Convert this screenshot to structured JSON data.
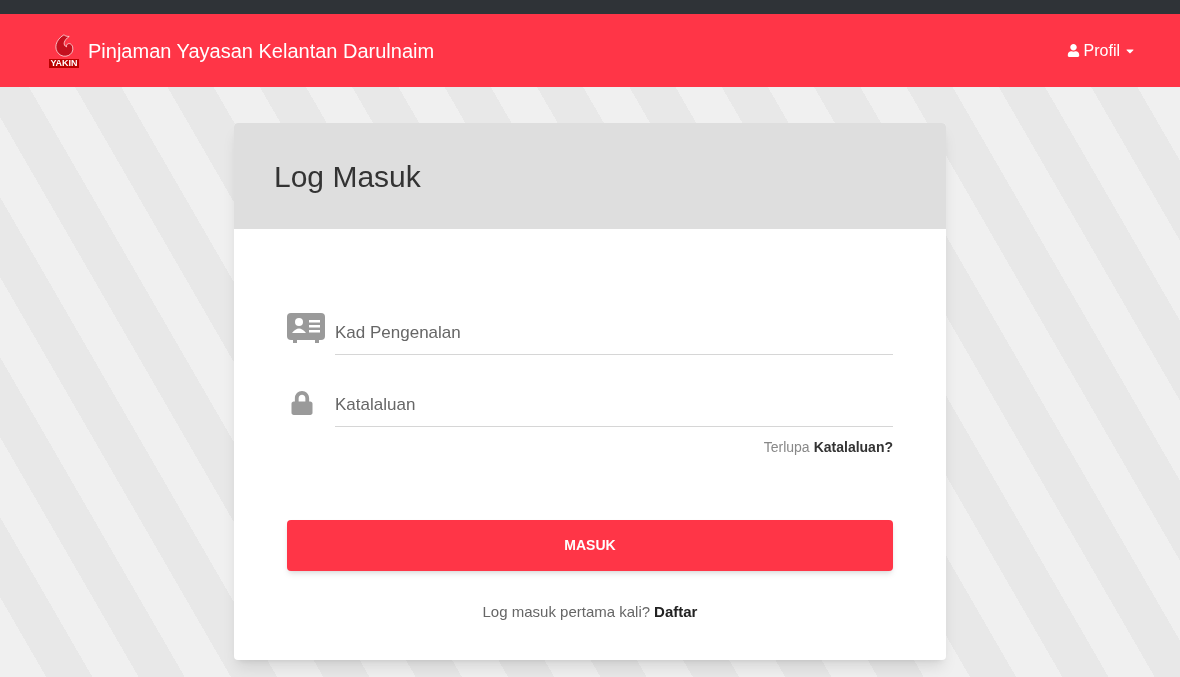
{
  "navbar": {
    "logo_text": "YAKIN",
    "title": "Pinjaman Yayasan Kelantan Darulnaim",
    "profile": "Profil"
  },
  "login_card": {
    "title": "Log Masuk",
    "fields": [
      {
        "kind": "id",
        "placeholder": "Kad Pengenalan"
      },
      {
        "kind": "password",
        "placeholder": "Katalaluan"
      }
    ],
    "forgot": {
      "text": "Terlupa",
      "link": "Katalaluan?"
    },
    "submit": "MASUK",
    "signup": {
      "text": "Log masuk pertama kali?",
      "link": "Daftar"
    }
  }
}
